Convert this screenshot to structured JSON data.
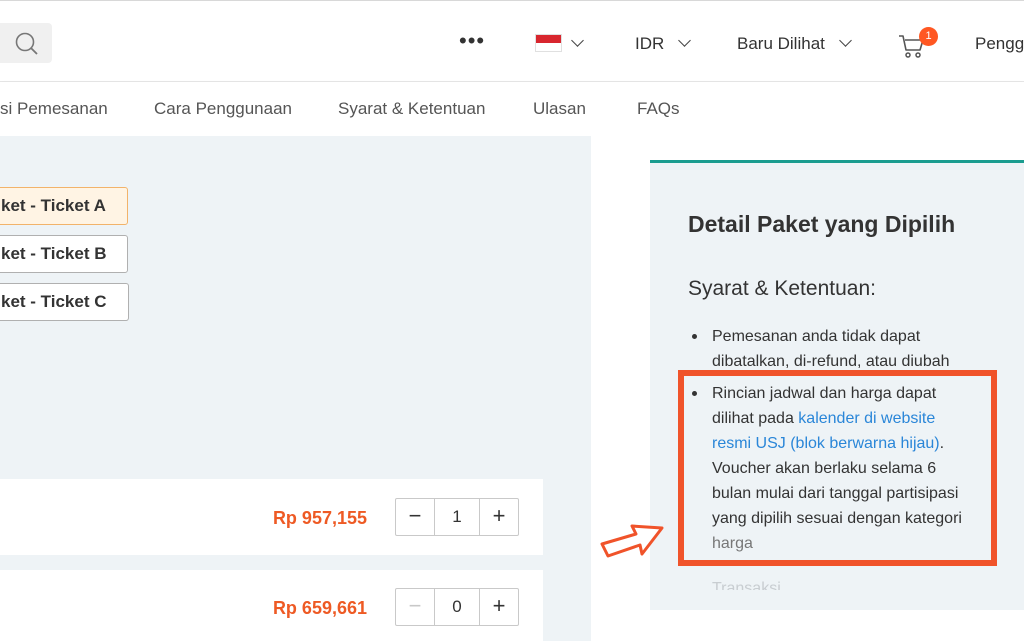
{
  "header": {
    "more_glyph": "•••",
    "currency": "IDR",
    "recently_viewed": "Baru Dilihat",
    "cart_count": "1",
    "user_text": "Pengg"
  },
  "tabs": [
    {
      "label": "si Pemesanan"
    },
    {
      "label": "Cara Penggunaan"
    },
    {
      "label": "Syarat & Ketentuan"
    },
    {
      "label": "Ulasan"
    },
    {
      "label": "FAQs"
    }
  ],
  "packages": [
    {
      "label": "ket - Ticket A",
      "selected": true
    },
    {
      "label": "ket - Ticket B",
      "selected": false
    },
    {
      "label": "ket - Ticket C",
      "selected": false
    }
  ],
  "quantity_rows": [
    {
      "price": "Rp 957,155",
      "quantity": "1",
      "minus": "−",
      "plus": "+"
    },
    {
      "price": "Rp 659,661",
      "quantity": "0",
      "minus": "−",
      "plus": "+"
    }
  ],
  "detail": {
    "title": "Detail Paket yang Dipilih",
    "terms_heading": "Syarat & Ketentuan:",
    "bullet1": [
      "Pemesanan anda tidak dapat",
      "dibatalkan, di-refund, atau diubah"
    ],
    "bullet2": {
      "line1": "Rincian jadwal dan harga dapat",
      "line2_pre": "dilihat pada ",
      "line2_link": "kalender di website",
      "line3_link": "resmi USJ (blok berwarna hijau)",
      "line3_post": ".",
      "line4": "Voucher akan berlaku selama 6",
      "line5": "bulan mulai dari tanggal partisipasi",
      "line6": "yang dipilih sesuai dengan kategori",
      "line7": "harga"
    },
    "cut_off": "Transaksi"
  },
  "colors": {
    "accent_price": "#ee5a24",
    "highlight_box": "#f0532a",
    "link": "#2a86d8",
    "panel_top_border": "#1a9c8f",
    "cart_badge": "#ff5722"
  },
  "icons": [
    "search-icon",
    "more-icon",
    "indonesia-flag-icon",
    "chevron-down-icon",
    "cart-icon",
    "arrow-pointer-icon"
  ]
}
